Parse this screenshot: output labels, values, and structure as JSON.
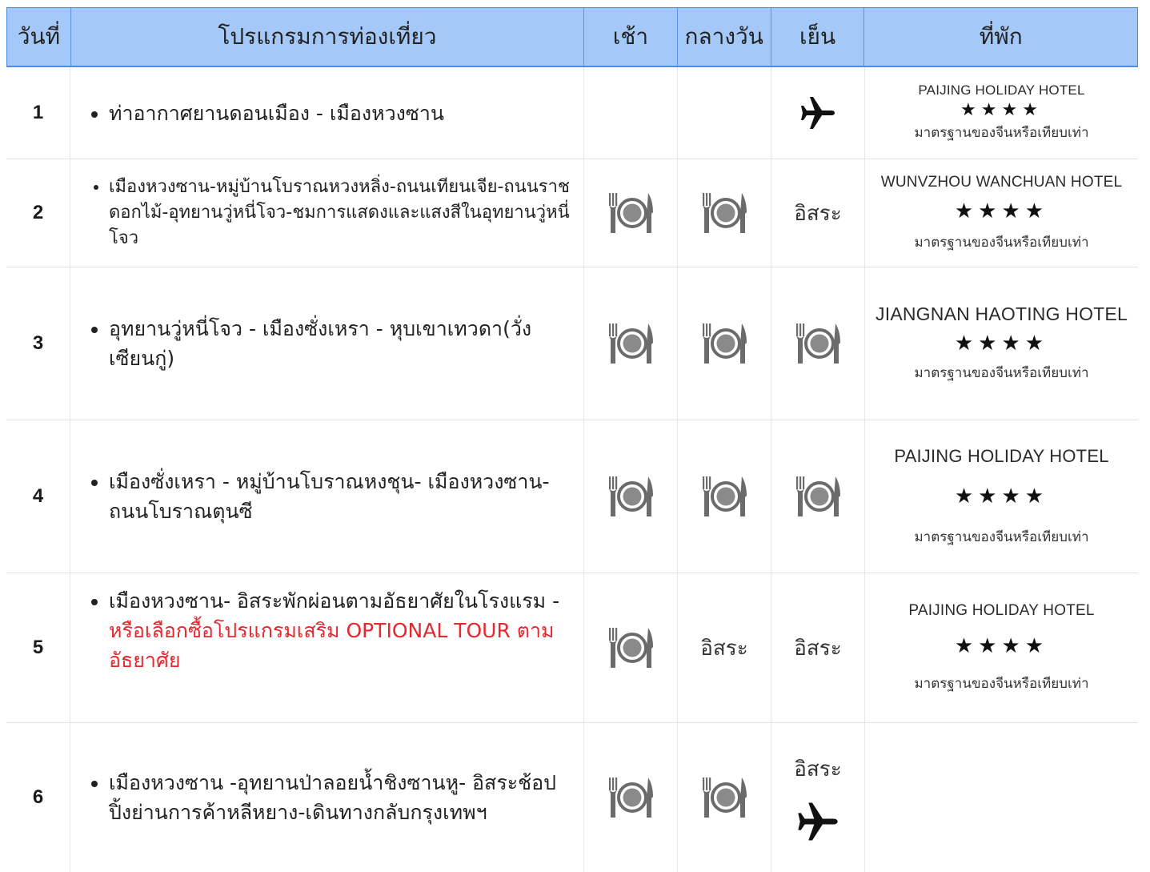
{
  "header": {
    "day": "วันที่",
    "program": "โปรแกรมการท่องเที่ยว",
    "breakfast": "เช้า",
    "lunch": "กลางวัน",
    "dinner": "เย็น",
    "hotel": "ที่พัก"
  },
  "days": [
    {
      "num": "1",
      "program": "ท่าอากาศยานดอนเมือง - เมืองหวงซาน",
      "dinner_icon": "airplane-icon",
      "hotel_name": "PAIJING HOLIDAY HOTEL",
      "hotel_stars": "★★★★",
      "hotel_note": "มาตรฐานของจีนหรือเทียบเท่า"
    },
    {
      "num": "2",
      "program": "เมืองหวงซาน-หมู่บ้านโบราณหวงหลิ่ง-ถนนเทียนเจีย-ถนนราชดอกไม้-อุทยานวู่หนี่โจว-ชมการแสดงและแสงสีในอุทยานวู่หนี่โจว",
      "breakfast_icon": "meal-icon",
      "lunch_icon": "meal-icon",
      "dinner": "อิสระ",
      "hotel_name": "WUNVZHOU WANCHUAN  HOTEL",
      "hotel_stars": "★★★★",
      "hotel_note": "มาตรฐานของจีนหรือเทียบเท่า"
    },
    {
      "num": "3",
      "program": "อุทยานวู่หนี่โจว - เมืองซั่งเหรา - หุบเขาเทวดา(วั่งเซียนกู่)",
      "breakfast_icon": "meal-icon",
      "lunch_icon": "meal-icon",
      "dinner_icon": "meal-icon",
      "hotel_name": "JIANGNAN HAOTING HOTEL",
      "hotel_stars": "★★★★",
      "hotel_note": "มาตรฐานของจีนหรือเทียบเท่า"
    },
    {
      "num": "4",
      "program": "เมืองซั่งเหรา - หมู่บ้านโบราณหงชุน- เมืองหวงซาน-ถนนโบราณตุนซี",
      "breakfast_icon": "meal-icon",
      "lunch_icon": "meal-icon",
      "dinner_icon": "meal-icon",
      "hotel_name": "PAIJING HOLIDAY HOTEL",
      "hotel_stars": "★★★★",
      "hotel_note": "มาตรฐานของจีนหรือเทียบเท่า"
    },
    {
      "num": "5",
      "program_plain": "เมืองหวงซาน- อิสระพักผ่อนตามอัธยาศัยในโรงแรม - ",
      "program_red": "หรือเลือกซื้อโปรแกรมเสริม OPTIONAL TOUR ตามอัธยาศัย",
      "breakfast_icon": "meal-icon",
      "lunch": "อิสระ",
      "dinner": "อิสระ",
      "hotel_name": "PAIJING HOLIDAY HOTEL",
      "hotel_stars": "★★★★",
      "hotel_note": "มาตรฐานของจีนหรือเทียบเท่า"
    },
    {
      "num": "6",
      "program": "เมืองหวงซาน -อุทยานป่าลอยน้ำชิงซานหู- อิสระช้อปปิ้งย่านการค้าหลีหยาง-เดินทางกลับกรุงเทพฯ",
      "breakfast_icon": "meal-icon",
      "lunch_icon": "meal-icon",
      "dinner": "อิสระ",
      "dinner_icon": "airplane-icon"
    }
  ],
  "colors": {
    "header_bg": "#a4c8f7",
    "header_border": "#4f8be0",
    "highlight_red": "#e8262d",
    "icon_gray": "#6b6b6b"
  }
}
